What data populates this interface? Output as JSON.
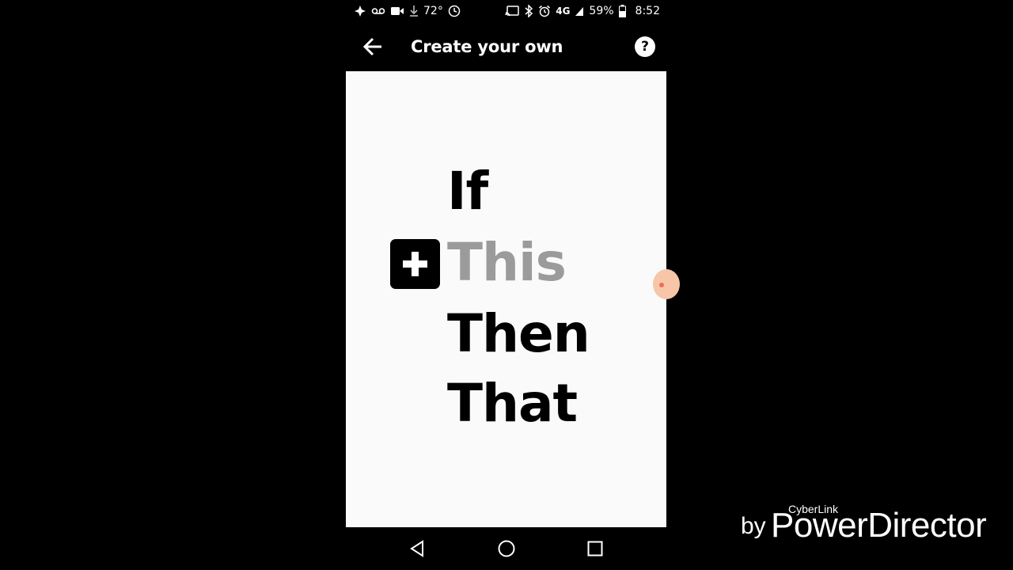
{
  "status_bar": {
    "temperature": "72°",
    "battery_percent": "59%",
    "time": "8:52",
    "network_label": "4G",
    "icons_left": [
      "pinwheel-icon",
      "voicemail-icon",
      "video-icon",
      "download-icon",
      "temperature-gauge-icon"
    ],
    "icons_right": [
      "cast-icon",
      "bluetooth-icon",
      "alarm-icon",
      "signal-icon",
      "battery-icon"
    ]
  },
  "app_bar": {
    "back_icon": "arrow-left-icon",
    "title": "Create your own",
    "help_label": "?"
  },
  "builder": {
    "line_if": "If",
    "line_this": "This",
    "line_then": "Then",
    "line_that": "That",
    "add_icon": "plus-icon",
    "this_color": "#9b9b9b"
  },
  "nav_bar": {
    "buttons": [
      "back-triangle-icon",
      "home-circle-icon",
      "recents-square-icon"
    ]
  },
  "watermark": {
    "by": "by",
    "brand_small": "CyberLink",
    "brand": "PowerDirector"
  }
}
